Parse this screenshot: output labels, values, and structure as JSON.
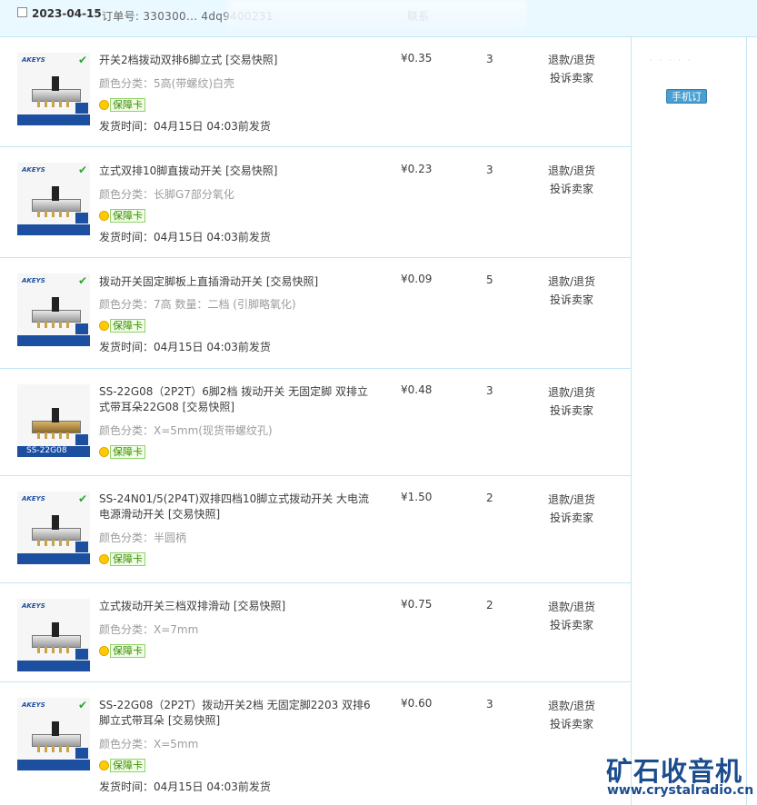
{
  "header": {
    "date": "2023-04-15",
    "order_label": "订单号: 330300... 4dq9400231",
    "contact": "联系"
  },
  "side": {
    "mobile_order": "手机订单"
  },
  "colors": {
    "border": "#c4e6f6",
    "header_bg": "#eaf8ff",
    "badge_green": "#3a8a00",
    "brand_blue": "#1d4fa0"
  },
  "items": [
    {
      "title": "开关2档拨动双排6脚立式 [交易快照]",
      "sku": "颜色分类：5高(带螺纹)白壳",
      "badge": "保障卡",
      "ship": "发货时间：04月15日 04:03前发货",
      "price": "¥0.35",
      "qty": "3",
      "refund": "退款/退货",
      "complain": "投诉卖家",
      "brand": "AKEYS"
    },
    {
      "title": "立式双排10脚直拨动开关 [交易快照]",
      "sku": "颜色分类：长脚G7部分氧化",
      "badge": "保障卡",
      "ship": "发货时间：04月15日 04:03前发货",
      "price": "¥0.23",
      "qty": "3",
      "refund": "退款/退货",
      "complain": "投诉卖家",
      "brand": "AKEYS"
    },
    {
      "title": "拨动开关固定脚板上直插滑动开关 [交易快照]",
      "sku": "颜色分类：7高  数量：二档 (引脚略氧化)",
      "badge": "保障卡",
      "ship": "发货时间：04月15日 04:03前发货",
      "price": "¥0.09",
      "qty": "5",
      "refund": "退款/退货",
      "complain": "投诉卖家",
      "brand": "AKEYS"
    },
    {
      "title": "SS-22G08（2P2T）6脚2档 拨动开关 无固定脚 双排立式带耳朵22G08 [交易快照]",
      "sku": "颜色分类：X=5mm(现货带螺纹孔)",
      "badge": "保障卡",
      "ship": "",
      "price": "¥0.48",
      "qty": "3",
      "refund": "退款/退货",
      "complain": "投诉卖家",
      "brand": "SS-22G08"
    },
    {
      "title": "SS-24N01/5(2P4T)双排四档10脚立式拨动开关 大电流电源滑动开关 [交易快照]",
      "sku": "颜色分类：半圆柄",
      "badge": "保障卡",
      "ship": "",
      "price": "¥1.50",
      "qty": "2",
      "refund": "退款/退货",
      "complain": "投诉卖家",
      "brand": "AKEYS"
    },
    {
      "title": "立式拨动开关三档双排滑动 [交易快照]",
      "sku": "颜色分类：X=7mm",
      "badge": "保障卡",
      "ship": "",
      "price": "¥0.75",
      "qty": "2",
      "refund": "退款/退货",
      "complain": "投诉卖家",
      "brand": "AKEYS"
    },
    {
      "title": "SS-22G08（2P2T）拨动开关2档 无固定脚2203 双排6脚立式带耳朵 [交易快照]",
      "sku": "颜色分类：X=5mm",
      "badge": "保障卡",
      "ship": "发货时间：04月15日 04:03前发货",
      "price": "¥0.60",
      "qty": "3",
      "refund": "退款/退货",
      "complain": "投诉卖家",
      "brand": "AKEYS"
    }
  ],
  "watermark": {
    "cn": "矿石收音机",
    "url": "www.crystalradio.cn"
  }
}
